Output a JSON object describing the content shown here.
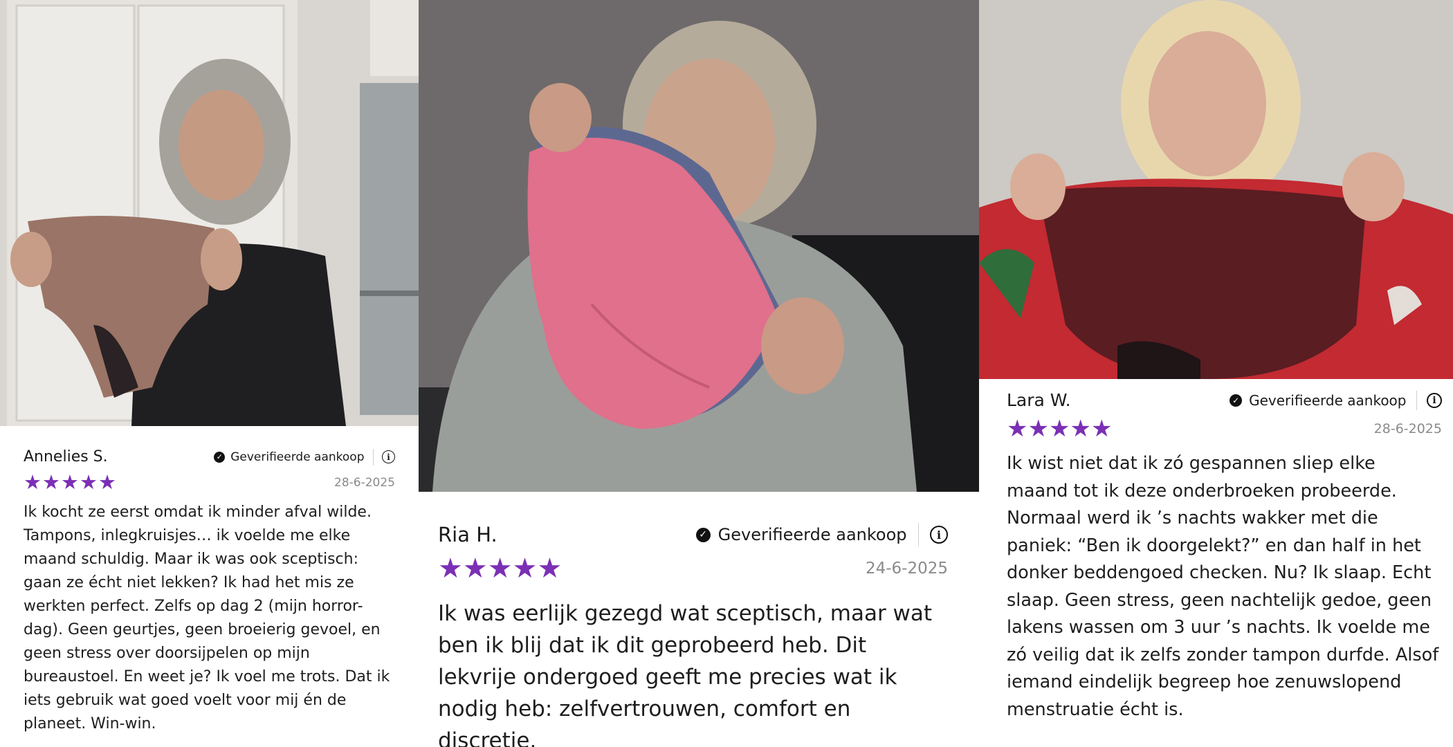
{
  "reviews": [
    {
      "author": "Annelies S.",
      "verified_label": "Geverifieerde aankoop",
      "rating": 5,
      "date": "28-6-2025",
      "text": "Ik kocht ze eerst omdat ik minder afval wilde. Tampons, inlegkruisjes… ik voelde me elke maand schuldig. Maar ik was ook sceptisch: gaan ze écht niet lekken? Ik had het mis ze werkten perfect. Zelfs op dag 2 (mijn horror-dag). Geen geurtjes, geen broeierig gevoel, en geen stress over doorsijpelen op mijn bureaustoel. En weet je? Ik voel me trots. Dat ik iets gebruik wat goed voelt voor mij én de planeet. Win-win.",
      "photo_icon": "customer-photo",
      "photo_colors": {
        "bg": "#d9d6d1",
        "product": "#9a7466",
        "top": "#1f1f22"
      }
    },
    {
      "author": "Ria H.",
      "verified_label": "Geverifieerde aankoop",
      "rating": 5,
      "date": "24-6-2025",
      "text": "Ik was eerlijk gezegd wat sceptisch, maar wat ben ik blij dat ik dit geprobeerd heb. Dit lekvrije ondergoed geeft me precies wat ik nodig heb: zelfvertrouwen, comfort en discretie.",
      "photo_icon": "customer-photo",
      "photo_colors": {
        "bg": "#6e6a6b",
        "product": "#e0708c",
        "top": "#9a9e9a"
      }
    },
    {
      "author": "Lara W.",
      "verified_label": "Geverifieerde aankoop",
      "rating": 5,
      "date": "28-6-2025",
      "text": "Ik wist niet dat ik zó gespannen sliep elke maand tot ik deze onderbroeken probeerde. Normaal werd ik ’s nachts wakker met die paniek: “Ben ik doorgelekt?” en dan half in het donker beddengoed checken. Nu? Ik slaap. Echt slaap. Geen stress, geen nachtelijk gedoe, geen lakens wassen om 3 uur ’s nachts. Ik voelde me zó veilig dat ik zelfs zonder tampon durfde. Alsof iemand eindelijk begreep hoe zenuwslopend menstruatie écht is.",
      "photo_icon": "customer-photo",
      "photo_colors": {
        "bg": "#cdc9c4",
        "product": "#5a1d22",
        "top": "#c32a32"
      }
    }
  ],
  "icons": {
    "star": "★",
    "check": "✓",
    "info": "i"
  },
  "colors": {
    "star": "#7b2fb5",
    "date": "#8a8a8a",
    "text": "#1e1e1e"
  }
}
